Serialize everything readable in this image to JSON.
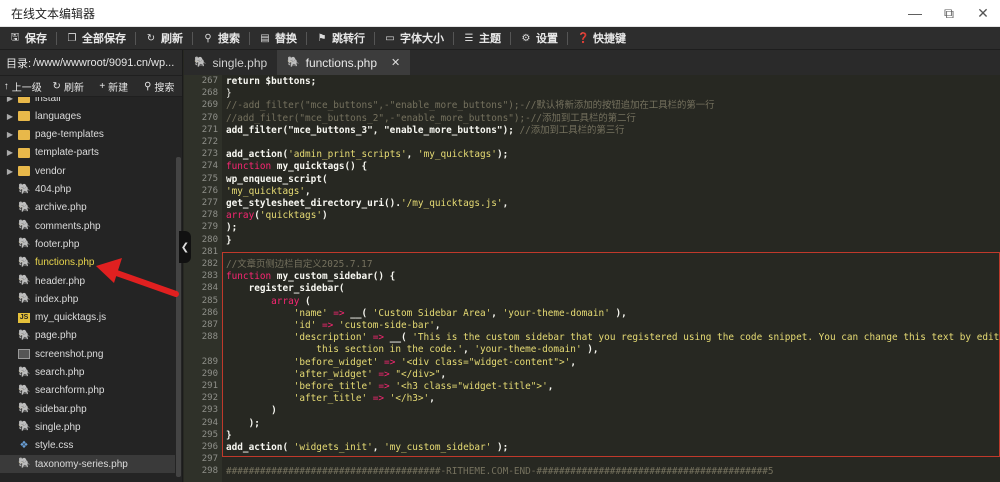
{
  "window": {
    "title": "在线文本编辑器",
    "min_icon": "minimize-icon",
    "max_icon": "maximize-icon",
    "close_icon": "close-icon"
  },
  "toolbar": [
    {
      "label": "保存",
      "icon": "save-icon",
      "glyph": "🖫"
    },
    {
      "label": "全部保存",
      "icon": "save-all-icon",
      "glyph": "❐"
    },
    {
      "label": "刷新",
      "icon": "refresh-icon",
      "glyph": "↻"
    },
    {
      "label": "搜索",
      "icon": "search-icon",
      "glyph": "⚲"
    },
    {
      "label": "替换",
      "icon": "replace-icon",
      "glyph": "▤"
    },
    {
      "label": "跳转行",
      "icon": "goto-line-icon",
      "glyph": "⚑"
    },
    {
      "label": "字体大小",
      "icon": "font-size-icon",
      "glyph": "▭"
    },
    {
      "label": "主题",
      "icon": "theme-icon",
      "glyph": "☰"
    },
    {
      "label": "设置",
      "icon": "settings-icon",
      "glyph": "⚙"
    },
    {
      "label": "快捷键",
      "icon": "shortcut-icon",
      "glyph": "❓"
    }
  ],
  "sidebar": {
    "path_label": "目录:",
    "path": "/www/wwwroot/9091.cn/wp...",
    "buttons": [
      {
        "label": "上一级",
        "icon": "up-arrow-icon",
        "glyph": "↑"
      },
      {
        "label": "刷新",
        "icon": "refresh-icon",
        "glyph": "↻"
      },
      {
        "label": "新建",
        "icon": "plus-icon",
        "glyph": "+"
      },
      {
        "label": "搜索",
        "icon": "search-icon",
        "glyph": "⚲"
      }
    ],
    "files": [
      {
        "name": "install",
        "type": "folder"
      },
      {
        "name": "languages",
        "type": "folder"
      },
      {
        "name": "page-templates",
        "type": "folder"
      },
      {
        "name": "template-parts",
        "type": "folder"
      },
      {
        "name": "vendor",
        "type": "folder"
      },
      {
        "name": "404.php",
        "type": "php"
      },
      {
        "name": "archive.php",
        "type": "php"
      },
      {
        "name": "comments.php",
        "type": "php"
      },
      {
        "name": "footer.php",
        "type": "php"
      },
      {
        "name": "functions.php",
        "type": "php",
        "active": true
      },
      {
        "name": "header.php",
        "type": "php"
      },
      {
        "name": "index.php",
        "type": "php"
      },
      {
        "name": "my_quicktags.js",
        "type": "js"
      },
      {
        "name": "page.php",
        "type": "php"
      },
      {
        "name": "screenshot.png",
        "type": "image"
      },
      {
        "name": "search.php",
        "type": "php"
      },
      {
        "name": "searchform.php",
        "type": "php"
      },
      {
        "name": "sidebar.php",
        "type": "php"
      },
      {
        "name": "single.php",
        "type": "php"
      },
      {
        "name": "style.css",
        "type": "css"
      },
      {
        "name": "taxonomy-series.php",
        "type": "php",
        "selected": true
      }
    ]
  },
  "tabs": [
    {
      "label": "single.php",
      "active": false
    },
    {
      "label": "functions.php",
      "active": true,
      "close": "✕"
    }
  ],
  "code": [
    {
      "n": "267",
      "t": [
        [
          "f",
          "return $buttons;"
        ]
      ]
    },
    {
      "n": "268",
      "t": [
        [
          "n",
          "}"
        ]
      ]
    },
    {
      "n": "269",
      "t": [
        [
          "c",
          "//-add_filter(\"mce_buttons\",-\"enable_more_buttons\");-//默认将新添加的按钮追加在工具栏的第一行"
        ]
      ]
    },
    {
      "n": "270",
      "t": [
        [
          "c",
          "//add_filter(\"mce_buttons_2\",-\"enable_more_buttons\");-//添加到工具栏的第二行"
        ]
      ]
    },
    {
      "n": "271",
      "t": [
        [
          "f",
          "add_filter(\"mce_buttons_3\", \"enable_more_buttons\");"
        ],
        [
          "c",
          " //添加到工具栏的第三行"
        ]
      ]
    },
    {
      "n": "272",
      "t": []
    },
    {
      "n": "273",
      "t": [
        [
          "f",
          "add_action("
        ],
        [
          "s",
          "'admin_print_scripts'"
        ],
        [
          "f",
          ", "
        ],
        [
          "s",
          "'my_quicktags'"
        ],
        [
          "f",
          ");"
        ]
      ]
    },
    {
      "n": "274",
      "t": [
        [
          "k",
          "function"
        ],
        [
          "f",
          " my_quicktags() {"
        ]
      ]
    },
    {
      "n": "275",
      "t": [
        [
          "f",
          "wp_enqueue_script("
        ]
      ]
    },
    {
      "n": "276",
      "t": [
        [
          "s",
          "'my_quicktags'"
        ],
        [
          "f",
          ","
        ]
      ]
    },
    {
      "n": "277",
      "t": [
        [
          "f",
          "get_stylesheet_directory_uri()."
        ],
        [
          "s",
          "'/my_quicktags.js'"
        ],
        [
          "f",
          ","
        ]
      ]
    },
    {
      "n": "278",
      "t": [
        [
          "k",
          "array"
        ],
        [
          "f",
          "("
        ],
        [
          "s",
          "'quicktags'"
        ],
        [
          "f",
          ")"
        ]
      ]
    },
    {
      "n": "279",
      "t": [
        [
          "f",
          ");"
        ]
      ]
    },
    {
      "n": "280",
      "t": [
        [
          "f",
          "}"
        ]
      ]
    },
    {
      "n": "281",
      "t": []
    },
    {
      "n": "282",
      "t": [
        [
          "c",
          "//文章页侧边栏自定义2025.7.17"
        ]
      ]
    },
    {
      "n": "283",
      "t": [
        [
          "k",
          "function"
        ],
        [
          "f",
          " my_custom_sidebar() {"
        ]
      ]
    },
    {
      "n": "284",
      "t": [
        [
          "f",
          "    register_sidebar("
        ]
      ]
    },
    {
      "n": "285",
      "t": [
        [
          "k",
          "        array"
        ],
        [
          "f",
          " ("
        ]
      ]
    },
    {
      "n": "286",
      "t": [
        [
          "s",
          "            'name'"
        ],
        [
          "k",
          " => "
        ],
        [
          "f",
          "__( "
        ],
        [
          "s",
          "'Custom Sidebar Area'"
        ],
        [
          "f",
          ", "
        ],
        [
          "s",
          "'your-theme-domain'"
        ],
        [
          "f",
          " ),"
        ]
      ]
    },
    {
      "n": "287",
      "t": [
        [
          "s",
          "            'id'"
        ],
        [
          "k",
          " => "
        ],
        [
          "s",
          "'custom-side-bar'"
        ],
        [
          "f",
          ","
        ]
      ]
    },
    {
      "n": "288",
      "t": [
        [
          "s",
          "            'description'"
        ],
        [
          "k",
          " => "
        ],
        [
          "f",
          "__( "
        ],
        [
          "s",
          "'This is the custom sidebar that you registered using the code snippet. You can change this text by editing"
        ]
      ]
    },
    {
      "n": "",
      "t": [
        [
          "s",
          "                this section in the code.'"
        ],
        [
          "f",
          ", "
        ],
        [
          "s",
          "'your-theme-domain'"
        ],
        [
          "f",
          " ),"
        ]
      ]
    },
    {
      "n": "289",
      "t": [
        [
          "s",
          "            'before_widget'"
        ],
        [
          "k",
          " => "
        ],
        [
          "s",
          "'<div class=\"widget-content\">'"
        ],
        [
          "f",
          ","
        ]
      ]
    },
    {
      "n": "290",
      "t": [
        [
          "s",
          "            'after_widget'"
        ],
        [
          "k",
          " => "
        ],
        [
          "s",
          "\"</div>\""
        ],
        [
          "f",
          ","
        ]
      ]
    },
    {
      "n": "291",
      "t": [
        [
          "s",
          "            'before_title'"
        ],
        [
          "k",
          " => "
        ],
        [
          "s",
          "'<h3 class=\"widget-title\">'"
        ],
        [
          "f",
          ","
        ]
      ]
    },
    {
      "n": "292",
      "t": [
        [
          "s",
          "            'after_title'"
        ],
        [
          "k",
          " => "
        ],
        [
          "s",
          "'</h3>'"
        ],
        [
          "f",
          ","
        ]
      ]
    },
    {
      "n": "293",
      "t": [
        [
          "f",
          "        )"
        ]
      ]
    },
    {
      "n": "294",
      "t": [
        [
          "f",
          "    );"
        ]
      ]
    },
    {
      "n": "295",
      "t": [
        [
          "f",
          "}"
        ]
      ]
    },
    {
      "n": "296",
      "t": [
        [
          "f",
          "add_action( "
        ],
        [
          "s",
          "'widgets_init'"
        ],
        [
          "f",
          ", "
        ],
        [
          "s",
          "'my_custom_sidebar'"
        ],
        [
          "f",
          " );"
        ]
      ]
    },
    {
      "n": "297",
      "t": []
    },
    {
      "n": "298",
      "t": [
        [
          "c",
          "######################################-RITHEME.COM-END-#########################################5"
        ]
      ]
    }
  ],
  "colors": {
    "annotation": "#e02020",
    "highlight_box": "#c0392b",
    "active_file": "#e8d44d"
  }
}
